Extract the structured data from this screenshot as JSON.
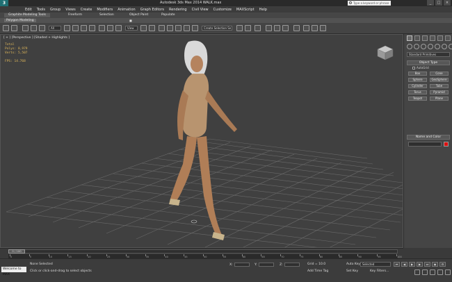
{
  "window": {
    "logo": "3",
    "title": "Autodesk 3ds Max  2014     WALK.max",
    "search_placeholder": "Type a keyword or phrase",
    "controls": [
      "_",
      "□",
      "×"
    ]
  },
  "menu": [
    "Edit",
    "Tools",
    "Group",
    "Views",
    "Create",
    "Modifiers",
    "Animation",
    "Graph Editors",
    "Rendering",
    "Civil View",
    "Customize",
    "MAXScript",
    "Help"
  ],
  "ribbon": {
    "tabs": [
      "Graphite Modeling Tools",
      "Freeform",
      "Selection",
      "Object Paint",
      "Populate"
    ],
    "active_tab": "Graphite Modeling Tools",
    "sub_label": "Polygon Modeling",
    "sub_badge": "■"
  },
  "toolbar": {
    "undo_scope": "All",
    "reference": "View",
    "named_selection": "Create Selection Se"
  },
  "viewport": {
    "label": "[ + ] [Perspective ] [Shaded + Highlights ]",
    "stats": [
      "Total",
      "Polys:  8,979",
      "Verts:  5,507",
      "",
      "FPS:    14.768"
    ]
  },
  "command_panel": {
    "category": "Standard Primitives",
    "object_type_header": "Object Type",
    "auto_grid": "AutoGrid",
    "objects": [
      "Box",
      "Cone",
      "Sphere",
      "GeoSphere",
      "Cylinder",
      "Tube",
      "Torus",
      "Pyramid",
      "Teapot",
      "Plane"
    ],
    "name_color_header": "Name and Color",
    "name_value": "",
    "accent_color": "#e01010"
  },
  "timeline": {
    "frame_display": "0 / 100",
    "ticks": [
      "0",
      "5",
      "10",
      "15",
      "20",
      "25",
      "30",
      "35",
      "40",
      "45",
      "50",
      "55",
      "60",
      "65",
      "70",
      "75",
      "80",
      "85",
      "90",
      "95",
      "100"
    ]
  },
  "status": {
    "welcome": "Welcome to MAX",
    "selection": "None Selected",
    "prompt": "Click or click-and-drag to select objects",
    "x_label": "X:",
    "y_label": "Y:",
    "z_label": "Z:",
    "grid": "Grid = 10.0",
    "add_time_tag": "Add Time Tag",
    "auto_key": "Auto Key",
    "set_key": "Set Key",
    "selected": "Selected",
    "key_filters": "Key Filters..."
  }
}
